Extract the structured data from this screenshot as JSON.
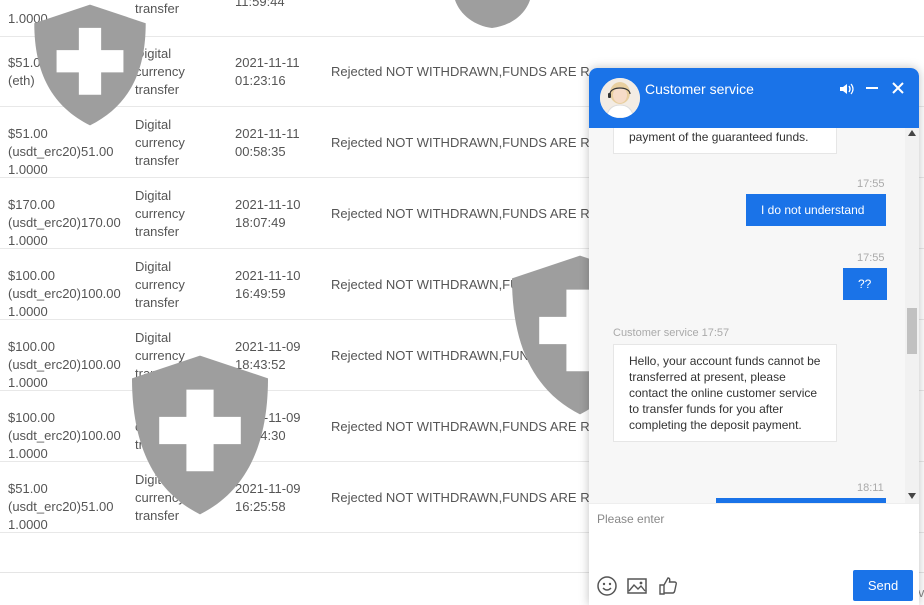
{
  "table": {
    "top_partial": {
      "amount": "1.0000",
      "type": "transfer",
      "time": "11:59:44"
    },
    "rows": [
      {
        "amount": "$51.00\n(eth)",
        "type": "Digital\ncurrency\ntransfer",
        "time": "2021-11-11\n01:23:16",
        "status": "Rejected NOT WITHDRAWN,FUNDS ARE R"
      },
      {
        "amount": "$51.00\n(usdt_erc20)51.00\n1.0000",
        "type": "Digital\ncurrency\ntransfer",
        "time": "2021-11-11\n00:58:35",
        "status": "Rejected NOT WITHDRAWN,FUNDS ARE R"
      },
      {
        "amount": "$170.00\n(usdt_erc20)170.00\n1.0000",
        "type": "Digital\ncurrency\ntransfer",
        "time": "2021-11-10\n18:07:49",
        "status": "Rejected NOT WITHDRAWN,FUNDS ARE R"
      },
      {
        "amount": "$100.00\n(usdt_erc20)100.00\n1.0000",
        "type": "Digital\ncurrency\ntransfer",
        "time": "2021-11-10\n16:49:59",
        "status": "Rejected NOT WITHDRAWN,FUNDS ARE R"
      },
      {
        "amount": "$100.00\n(usdt_erc20)100.00\n1.0000",
        "type": "Digital\ncurrency\ntransfer",
        "time": "2021-11-09\n18:43:52",
        "status": "Rejected NOT WITHDRAWN,FUNDS ARE R"
      },
      {
        "amount": "$100.00\n(usdt_erc20)100.00\n1.0000",
        "type": "Digital\ncurrency\ntransfer",
        "time": "2021-11-09\n18:14:30",
        "status": "Rejected NOT WITHDRAWN,FUNDS ARE R"
      },
      {
        "amount": "$51.00\n(usdt_erc20)51.00\n1.0000",
        "type": "Digital\ncurrency\ntransfer",
        "time": "2021-11-09\n16:25:58",
        "status": "Rejected NOT WITHDRAWN,FUNDS ARE R"
      }
    ],
    "bottom_fragment": "v"
  },
  "chat": {
    "title": "Customer service",
    "messages": {
      "m0_text": "payment of the guaranteed funds.",
      "m1_time": "17:55",
      "m1_text": "I do not understand",
      "m2_time": "17:55",
      "m2_text": "??",
      "m3_header": "Customer service 17:57",
      "m3_text": "Hello, your account funds cannot be transferred at present, please contact the online customer service to transfer funds for you after completing the deposit payment.",
      "m4_time": "18:11"
    },
    "input_placeholder": "Please enter",
    "send_label": "Send"
  },
  "colors": {
    "accent": "#1a73e8",
    "watermark": "#9e9e9e"
  },
  "icons": [
    "sound-icon",
    "minimize-icon",
    "close-icon",
    "emoji-icon",
    "image-icon",
    "thumbs-up-icon"
  ]
}
